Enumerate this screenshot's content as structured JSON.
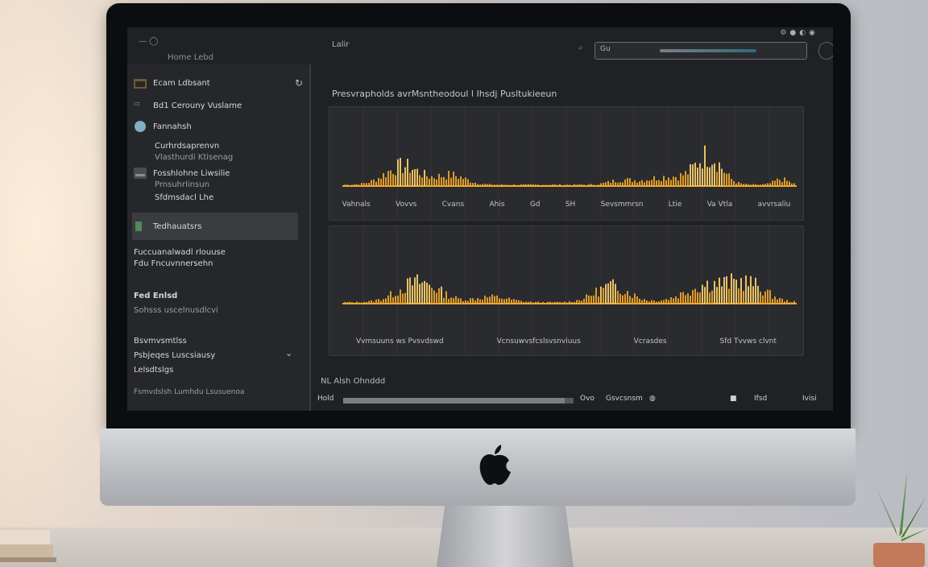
{
  "topbar": {
    "title": "Lalir",
    "menu_left": "Home Lebd",
    "field_value": "Gu",
    "icons": [
      "settings-icon",
      "bell-icon",
      "user-icon",
      "more-icon"
    ]
  },
  "sidebar": {
    "items": [
      {
        "label": "Ecam Ldbsant",
        "icon": "folder-icon"
      },
      {
        "label": "Bd1 Cerouny Vuslame",
        "icon": "chip-icon"
      },
      {
        "label": "Fannahsh",
        "icon": "globe-icon"
      },
      {
        "label": "Curhrdsaprenvn",
        "icon": "none"
      },
      {
        "label": "Vlasthurdi Ktisenag",
        "icon": "none"
      },
      {
        "label": "Fosshlohne Liwsilie",
        "icon": "drive-icon"
      },
      {
        "label": "Prnsuhrlinsun",
        "icon": "none"
      },
      {
        "label": "Sfdmsdacl Lhe",
        "icon": "none"
      },
      {
        "label": "Tedhauatsrs",
        "icon": "square-icon"
      },
      {
        "label": "Fuccuanalwadl rlouuse",
        "icon": "none"
      },
      {
        "label": "Fdu Fncuvnnersehn",
        "icon": "none"
      },
      {
        "label": "Fed Enlsd",
        "icon": "none"
      },
      {
        "label": "Sohsss uscelnusdlcvi",
        "icon": "none"
      },
      {
        "label": "Bsvmvsmtlss",
        "icon": "none"
      },
      {
        "label": "Psbjeqes Luscsiausy",
        "icon": "none"
      },
      {
        "label": "Lelsdtslgs",
        "icon": "none"
      },
      {
        "label": "Fsmvdslsh Lumhdu Lsusuenoa",
        "icon": "none"
      }
    ]
  },
  "main": {
    "title": "Presvrapholds avrMsntheodoul l Ihsdj Pusltukieeun",
    "panel1_ticks": [
      "Vahnals",
      "Vovvs",
      "Cvans",
      "Ahis",
      "Gd",
      "SH",
      "Sevsmmrsn",
      "Ltie",
      "Va Vtla",
      "avvrsaliu"
    ],
    "panel2_ticks": [
      "Vvmsuuns ws Pvsvdswd",
      "Vcnsuwvsfcslsvsnviuus",
      "Vcrasdes",
      "Sfd Tvvws clvnt"
    ],
    "time_label": "NL Alsh Ohnddd",
    "transport": {
      "hold": "Hold",
      "progress": 0.96,
      "controls": [
        "Ovo",
        "Gsvcsnsm",
        "Ifsd",
        "Ivisi"
      ]
    }
  },
  "colors": {
    "waveform": "#f2a72a",
    "waveform_glow": "#ffd36b",
    "screen_bg": "#1b1c1f",
    "panel_bg": "#2a2b2f"
  }
}
